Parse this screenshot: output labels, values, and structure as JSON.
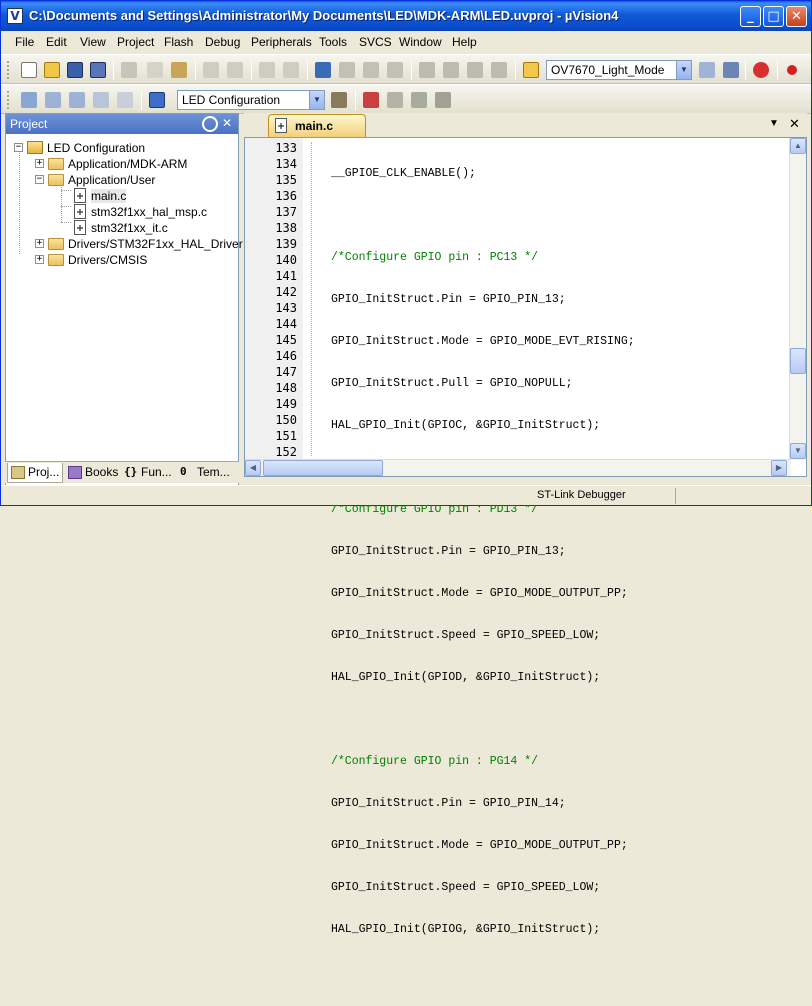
{
  "window": {
    "title": "C:\\Documents and Settings\\Administrator\\My Documents\\LED\\MDK-ARM\\LED.uvproj - µVision4",
    "minimize": "_",
    "maximize": "□",
    "close": "✕"
  },
  "menu": [
    "File",
    "Edit",
    "View",
    "Project",
    "Flash",
    "Debug",
    "Peripherals",
    "Tools",
    "SVCS",
    "Window",
    "Help"
  ],
  "toolbar1": {
    "target_combo": "OV7670_Light_Mode"
  },
  "toolbar2": {
    "config_combo": "LED Configuration"
  },
  "project_panel": {
    "title": "Project",
    "pin": "⌘",
    "close": "✕",
    "tree": [
      {
        "label": "LED Configuration",
        "type": "project",
        "expanded": true
      },
      {
        "label": "Application/MDK-ARM",
        "type": "folder",
        "expanded": false
      },
      {
        "label": "Application/User",
        "type": "folder",
        "expanded": true
      },
      {
        "label": "main.c",
        "type": "file"
      },
      {
        "label": "stm32f1xx_hal_msp.c",
        "type": "file"
      },
      {
        "label": "stm32f1xx_it.c",
        "type": "file"
      },
      {
        "label": "Drivers/STM32F1xx_HAL_Driver",
        "type": "folder",
        "expanded": false
      },
      {
        "label": "Drivers/CMSIS",
        "type": "folder",
        "expanded": false
      }
    ],
    "tabs": [
      "Proj...",
      "Books",
      "Fun...",
      "Tem..."
    ]
  },
  "editor": {
    "tab_label": "main.c",
    "dropdown": "▼",
    "close": "✕",
    "line_numbers": [
      "133",
      "134",
      "135",
      "136",
      "137",
      "138",
      "139",
      "140",
      "141",
      "142",
      "143",
      "144",
      "145",
      "146",
      "147",
      "148",
      "149",
      "150",
      "151",
      "152"
    ],
    "lines": [
      "__GPIOE_CLK_ENABLE();",
      "",
      "/*Configure GPIO pin : PC13 */",
      "GPIO_InitStruct.Pin = GPIO_PIN_13;",
      "GPIO_InitStruct.Mode = GPIO_MODE_EVT_RISING;",
      "GPIO_InitStruct.Pull = GPIO_NOPULL;",
      "HAL_GPIO_Init(GPIOC, &GPIO_InitStruct);",
      "",
      "/*Configure GPIO pin : PD13 */",
      "GPIO_InitStruct.Pin = GPIO_PIN_13;",
      "GPIO_InitStruct.Mode = GPIO_MODE_OUTPUT_PP;",
      "GPIO_InitStruct.Speed = GPIO_SPEED_LOW;",
      "HAL_GPIO_Init(GPIOD, &GPIO_InitStruct);",
      "",
      "/*Configure GPIO pin : PG14 */",
      "GPIO_InitStruct.Pin = GPIO_PIN_14;",
      "GPIO_InitStruct.Mode = GPIO_MODE_OUTPUT_PP;",
      "GPIO_InitStruct.Speed = GPIO_SPEED_LOW;",
      "HAL_GPIO_Init(GPIOG, &GPIO_InitStruct);",
      ""
    ],
    "comment_color": "#008000"
  },
  "statusbar": {
    "debugger": "ST-Link Debugger"
  },
  "colors": {
    "titlebar": "#0b4fd0",
    "panel_header": "#4a72c4",
    "tab_active": "#f3d078"
  }
}
